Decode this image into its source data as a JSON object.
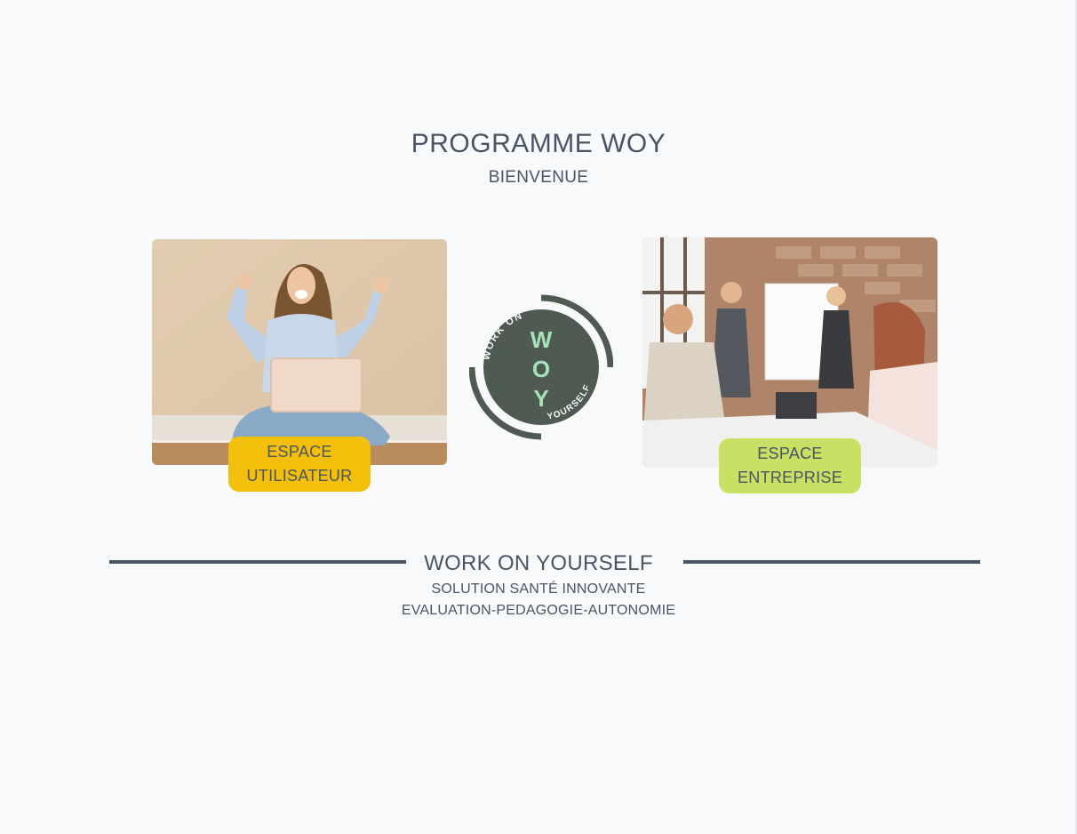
{
  "header": {
    "title": "PROGRAMME WOY",
    "subtitle": "BIENVENUE"
  },
  "cards": {
    "user": {
      "label_line1": "ESPACE",
      "label_line2": "UTILISATEUR",
      "badge_color": "#f3bf0b"
    },
    "company": {
      "label_line1": "ESPACE",
      "label_line2": "ENTREPRISE",
      "badge_color": "#c8e063"
    }
  },
  "logo": {
    "top_text": "WORK ON",
    "bottom_text": "YOURSELF",
    "letter_1": "W",
    "letter_2": "O",
    "letter_3": "Y",
    "ring_color": "#4f5a52",
    "letter_color": "#a6e3b8"
  },
  "footer": {
    "title": "WORK ON YOURSELF",
    "line1": "SOLUTION SANTÉ INNOVANTE",
    "line2": "EVALUATION-PEDAGOGIE-AUTONOMIE"
  },
  "colors": {
    "text": "#4a5563",
    "background": "#f8f9fb"
  }
}
